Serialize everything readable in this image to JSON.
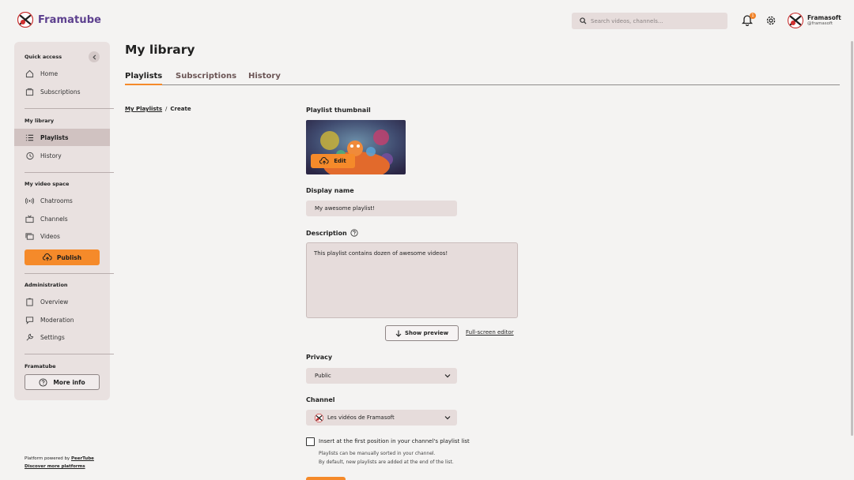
{
  "header": {
    "brand": "Framatube",
    "search_placeholder": "Search videos, channels...",
    "notification_count": "1",
    "user_name": "Framasoft",
    "user_handle": "@framasoft"
  },
  "sidebar": {
    "quick_access_title": "Quick access",
    "quick_items": [
      "Home",
      "Subscriptions"
    ],
    "library_title": "My library",
    "library_items": [
      "Playlists",
      "History"
    ],
    "video_space_title": "My video space",
    "video_items": [
      "Chatrooms",
      "Channels",
      "Videos"
    ],
    "publish_label": "Publish",
    "admin_title": "Administration",
    "admin_items": [
      "Overview",
      "Moderation",
      "Settings"
    ],
    "instance_title": "Framatube",
    "more_info_label": "More info"
  },
  "footer": {
    "powered_prefix": "Platform powered by ",
    "powered_link": "PeerTube",
    "discover": "Discover more platforms"
  },
  "main": {
    "title": "My library",
    "tabs": [
      "Playlists",
      "Subscriptions",
      "History"
    ],
    "breadcrumb_link": "My Playlists",
    "breadcrumb_sep": "/",
    "breadcrumb_current": "Create",
    "thumbnail_label": "Playlist thumbnail",
    "thumbnail_edit": "Edit",
    "display_name_label": "Display name",
    "display_name_value": "My awesome playlist!",
    "description_label": "Description",
    "description_value": "This playlist contains dozen of awesome videos!",
    "show_preview": "Show preview",
    "fullscreen_editor": "Full-screen editor",
    "privacy_label": "Privacy",
    "privacy_value": "Public",
    "channel_label": "Channel",
    "channel_value": "Les vidéos de Framasoft",
    "insert_first_label": "Insert at the first position in your channel's playlist list",
    "insert_help_1": "Playlists can be manually sorted in your channel.",
    "insert_help_2": "By default, new playlists are added at the end of the list."
  },
  "colors": {
    "accent": "#f58a2a",
    "brand": "#5c3f8e",
    "sidebar_bg": "#e9e1e0",
    "input_bg": "#e6dcdb"
  }
}
